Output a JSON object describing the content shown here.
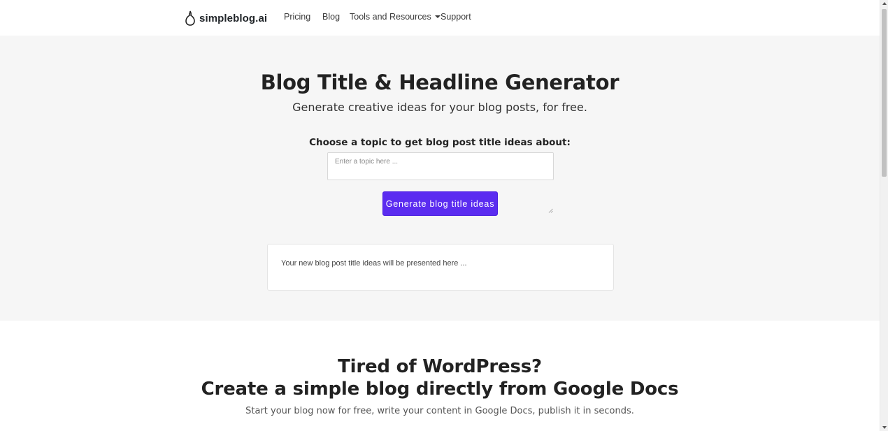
{
  "navbar": {
    "brand": "simpleblog.ai",
    "brand_icon": "drop-logo-icon",
    "links": {
      "pricing": "Pricing",
      "blog": "Blog",
      "tools": "Tools and Resources",
      "support": "Support"
    }
  },
  "hero": {
    "title": "Blog Title & Headline Generator",
    "subtitle": "Generate creative ideas for your blog posts, for free.",
    "topic_label": "Choose a topic to get blog post title ideas about:",
    "topic_placeholder": "Enter a topic here ...",
    "topic_value": "",
    "generate_button": "Generate blog title ideas",
    "result_placeholder": "Your new blog post title ideas will be presented here ..."
  },
  "promo": {
    "title_line1": "Tired of WordPress?",
    "title_line2": "Create a simple blog directly from Google Docs",
    "subtitle": "Start your blog now for free, write your content in Google Docs, publish it in seconds."
  },
  "colors": {
    "accent": "#5b2cf0",
    "hero_bg": "#f6f6f6",
    "text": "#212529"
  }
}
